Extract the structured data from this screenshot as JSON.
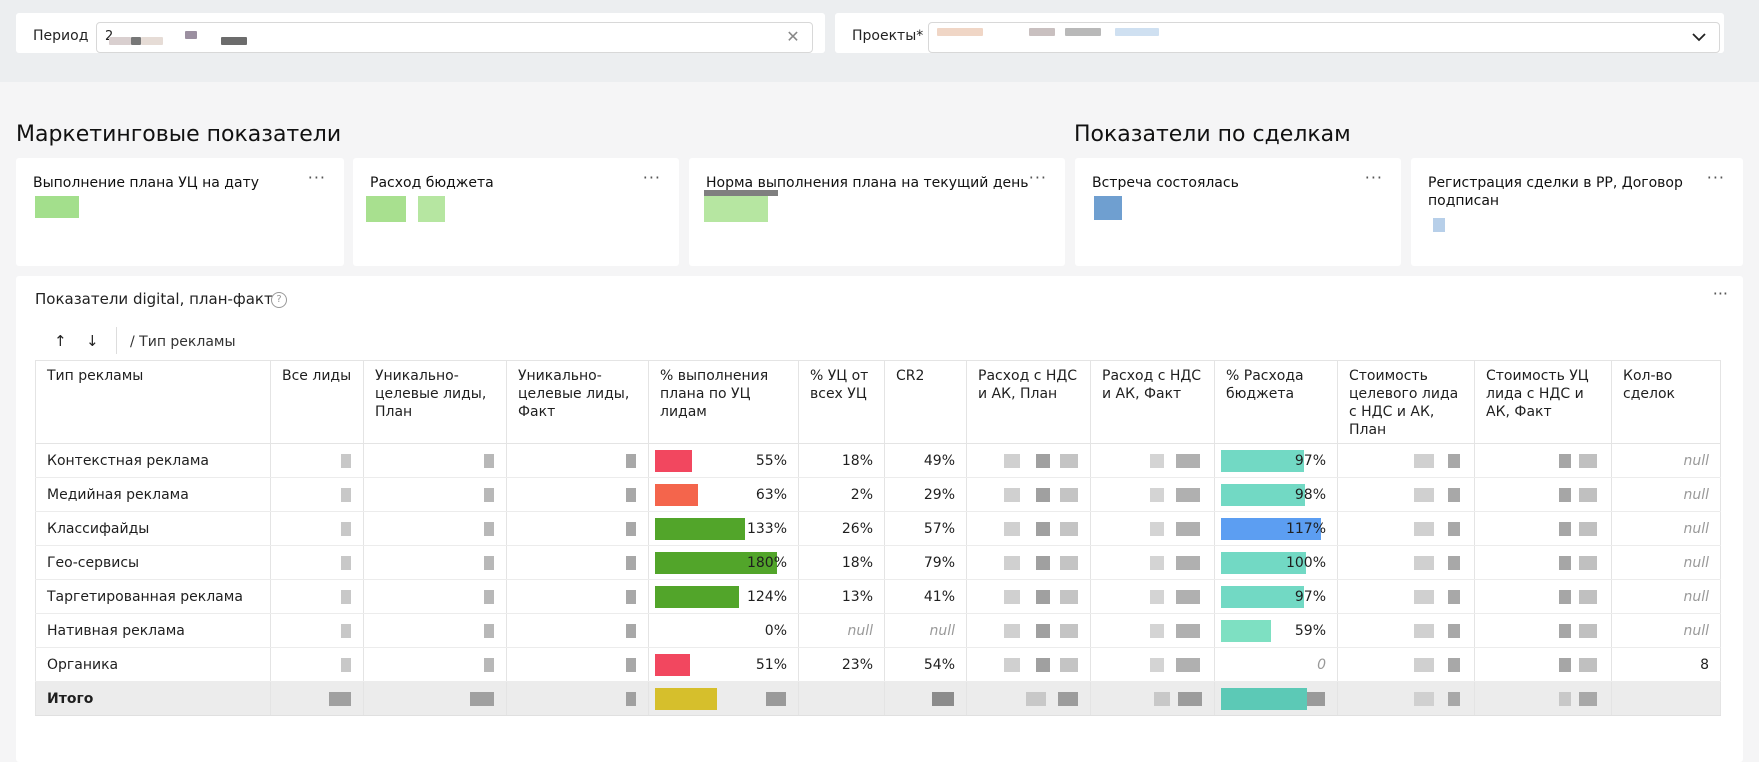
{
  "filters": {
    "period_label": "Период",
    "period_value": "2",
    "projects_label": "Проекты*"
  },
  "sections": {
    "marketing_title": "Маркетинговые показатели",
    "deals_title": "Показатели по сделкам"
  },
  "cards": [
    {
      "title": "Выполнение плана УЦ на дату",
      "menu": "···"
    },
    {
      "title": "Расход бюджета",
      "menu": "···"
    },
    {
      "title": "Норма выполнения плана на текущий день",
      "menu": "···"
    },
    {
      "title": "Встреча состоялась",
      "menu": "···"
    },
    {
      "title": "Регистрация сделки в РР, Договор подписан",
      "menu": "···"
    }
  ],
  "digital": {
    "title": "Показатели digital, план-факт",
    "help": "?",
    "menu": "···",
    "sort_up": "↑",
    "sort_down": "↓",
    "breadcrumb": "/ Тип рекламы",
    "columns": [
      "Тип рекламы",
      "Все лиды",
      "Уникально-целевые лиды, План",
      "Уникально-целевые лиды, Факт",
      "% выполнения плана по УЦ лидам",
      "% УЦ от всех УЦ",
      "CR2",
      "Расход с НДС и АК, План",
      "Расход с НДС и АК, Факт",
      "% Расхода бюджета",
      "Стоимость целевого лида с НДС и АК, План",
      "Стоимость УЦ лида с НДС и АК, Факт",
      "Кол-во сделок"
    ],
    "rows": [
      {
        "name": "Контекстная реклама",
        "plan_pct": "55%",
        "plan_val": 55,
        "plan_color": "#f2475f",
        "share": "18%",
        "cr2": "49%",
        "budget_pct": "97%",
        "budget_val": 97,
        "budget_color": "#72d9c4",
        "deals": "null"
      },
      {
        "name": "Медийная реклама",
        "plan_pct": "63%",
        "plan_val": 63,
        "plan_color": "#f4654c",
        "share": "2%",
        "cr2": "29%",
        "budget_pct": "98%",
        "budget_val": 98,
        "budget_color": "#72d9c4",
        "deals": "null"
      },
      {
        "name": "Классифайды",
        "plan_pct": "133%",
        "plan_val": 133,
        "plan_color": "#52a52a",
        "share": "26%",
        "cr2": "57%",
        "budget_pct": "117%",
        "budget_val": 117,
        "budget_color": "#5c9ef2",
        "deals": "null"
      },
      {
        "name": "Гео-сервисы",
        "plan_pct": "180%",
        "plan_val": 180,
        "plan_color": "#52a52a",
        "share": "18%",
        "cr2": "79%",
        "budget_pct": "100%",
        "budget_val": 100,
        "budget_color": "#72d9c4",
        "deals": "null"
      },
      {
        "name": "Таргетированная реклама",
        "plan_pct": "124%",
        "plan_val": 124,
        "plan_color": "#52a52a",
        "share": "13%",
        "cr2": "41%",
        "budget_pct": "97%",
        "budget_val": 97,
        "budget_color": "#72d9c4",
        "deals": "null"
      },
      {
        "name": "Нативная реклама",
        "plan_pct": "0%",
        "plan_val": 0,
        "plan_color": "#52a52a",
        "share": "null",
        "cr2": "null",
        "budget_pct": "59%",
        "budget_val": 59,
        "budget_color": "#7ee0c2",
        "deals": "null"
      },
      {
        "name": "Органика",
        "plan_pct": "51%",
        "plan_val": 51,
        "plan_color": "#f2475f",
        "share": "23%",
        "cr2": "54%",
        "budget_pct": "0",
        "budget_val": 0,
        "budget_color": "#72d9c4",
        "deals": "8"
      }
    ],
    "total_label": "Итого"
  }
}
